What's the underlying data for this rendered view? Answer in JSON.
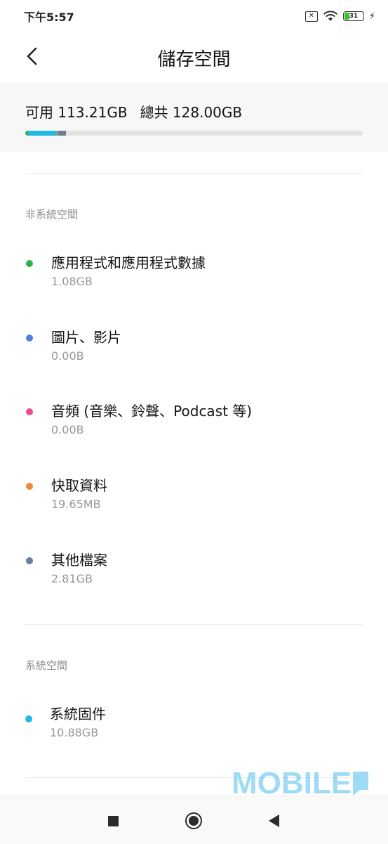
{
  "status_bar": {
    "time": "下午5:57",
    "battery_level": "31",
    "battery_fraction": 0.31,
    "icons": [
      "sim-disabled-icon",
      "wifi-icon",
      "battery-icon",
      "charging-bolt-icon"
    ]
  },
  "header": {
    "title": "儲存空間",
    "back_icon": "chevron-left-icon"
  },
  "summary": {
    "available": "可用 113.21GB",
    "total": "總共 128.00GB",
    "usage_segments": [
      {
        "name": "apps",
        "fraction": 0.0084,
        "color": "#2db24a"
      },
      {
        "name": "system",
        "fraction": 0.085,
        "color": "#21b8e6"
      },
      {
        "name": "cache",
        "fraction": 0.004,
        "color": "#f2883a"
      },
      {
        "name": "other",
        "fraction": 0.022,
        "color": "#6e7b99"
      }
    ]
  },
  "non_system": {
    "label": "非系統空間",
    "items": [
      {
        "title": "應用程式和應用程式數據",
        "size": "1.08GB",
        "color": "#2db24a"
      },
      {
        "title": "圖片、影片",
        "size": "0.00B",
        "color": "#4f82d6"
      },
      {
        "title": "音頻 (音樂、鈴聲、Podcast 等)",
        "size": "0.00B",
        "color": "#ea4a8a"
      },
      {
        "title": "快取資料",
        "size": "19.65MB",
        "color": "#f2883a"
      },
      {
        "title": "其他檔案",
        "size": "2.81GB",
        "color": "#6e7b99"
      }
    ]
  },
  "system": {
    "label": "系統空間",
    "items": [
      {
        "title": "系統固件",
        "size": "10.88GB",
        "color": "#21b8e6"
      }
    ]
  },
  "nav_bar": {
    "icons": [
      "recents-square-icon",
      "home-circle-icon",
      "back-triangle-icon"
    ]
  },
  "watermark": {
    "text": "MOBILE"
  }
}
